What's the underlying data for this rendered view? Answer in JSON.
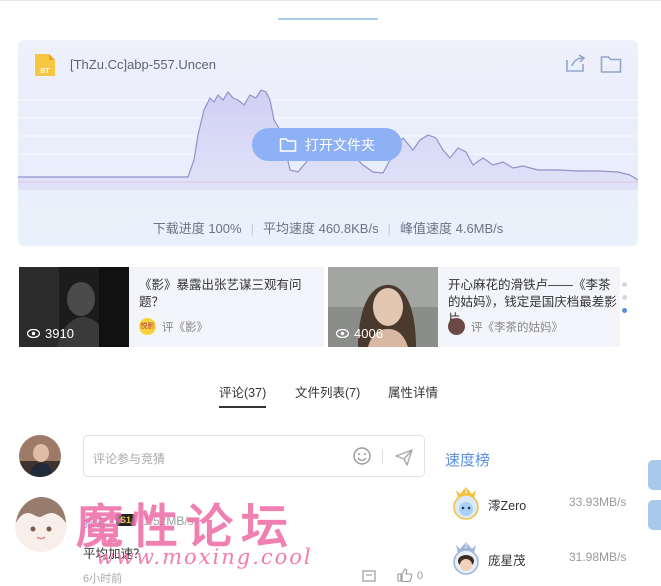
{
  "file": {
    "name": "[ThZu.Cc]abp-557.Uncen",
    "type_badge": "BT"
  },
  "actions": {
    "open_folder_label": "打开文件夹"
  },
  "stats": {
    "progress": "下载进度 100%",
    "avg_speed": "平均速度 460.8KB/s",
    "peak_speed": "峰值速度 4.6MB/s"
  },
  "news": [
    {
      "views": "3910",
      "title": "《影》暴露出张艺谋三观有问题？",
      "meta": "评《影》",
      "source_badge": "悦影"
    },
    {
      "views": "4006",
      "title": "开心麻花的滑铁卢——《李茶的姑妈》，钱定是国庆档最差影片",
      "meta": "评《李茶的姑妈》"
    }
  ],
  "tabs": [
    {
      "label": "评论(37)",
      "active": true
    },
    {
      "label": "文件列表(7)",
      "active": false
    },
    {
      "label": "属性详情",
      "active": false
    }
  ],
  "comment_input": {
    "placeholder": "评论参与竞猜"
  },
  "comment": {
    "user": "张睿",
    "level": "S1",
    "speed": "1.52MB/s",
    "text": "平均加速？",
    "time": "6小时前",
    "likes": "0"
  },
  "watermark": {
    "title": "魔性论坛",
    "url": "www.moxing.cool"
  },
  "ranking": {
    "title": "速度榜",
    "items": [
      {
        "rank": "1",
        "name": "澪Zero",
        "speed": "33.93MB/s"
      },
      {
        "rank": "2",
        "name": "庞星茂",
        "speed": "31.98MB/s"
      }
    ]
  },
  "colors": {
    "accent": "#5b8fdf",
    "button": "#8eb1f5",
    "watermark": "#f06fa8"
  }
}
